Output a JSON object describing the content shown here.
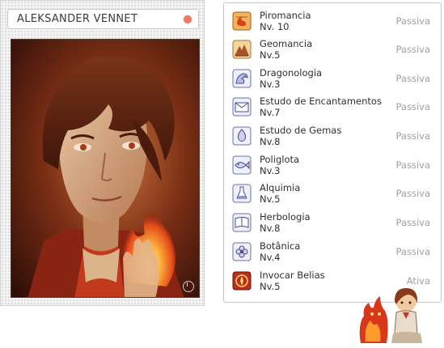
{
  "character": {
    "name": "ALEKSANDER VENNET",
    "status_color": "#ef7b66"
  },
  "skills": [
    {
      "name": "Piromancia",
      "level": "Nv. 10",
      "type": "Passiva",
      "icon": "fire-scroll-icon"
    },
    {
      "name": "Geomancia",
      "level": "Nv.5",
      "type": "Passiva",
      "icon": "mountain-icon"
    },
    {
      "name": "Dragonologia",
      "level": "Nv.3",
      "type": "Passiva",
      "icon": "dragon-icon"
    },
    {
      "name": "Estudo de Encantamentos",
      "level": "Nv.7",
      "type": "Passiva",
      "icon": "envelope-icon"
    },
    {
      "name": "Estudo de Gemas",
      "level": "Nv.8",
      "type": "Passiva",
      "icon": "gem-icon"
    },
    {
      "name": "Poliglota",
      "level": "Nv.3",
      "type": "Passiva",
      "icon": "fish-icon"
    },
    {
      "name": "Alquimia",
      "level": "Nv.5",
      "type": "Passiva",
      "icon": "flask-icon"
    },
    {
      "name": "Herbologia",
      "level": "Nv.8",
      "type": "Passiva",
      "icon": "herb-book-icon"
    },
    {
      "name": "Botânica",
      "level": "Nv.4",
      "type": "Passiva",
      "icon": "flower-icon"
    },
    {
      "name": "Invocar Belias",
      "level": "Nv.5",
      "type": "Ativa",
      "icon": "summon-icon"
    }
  ]
}
